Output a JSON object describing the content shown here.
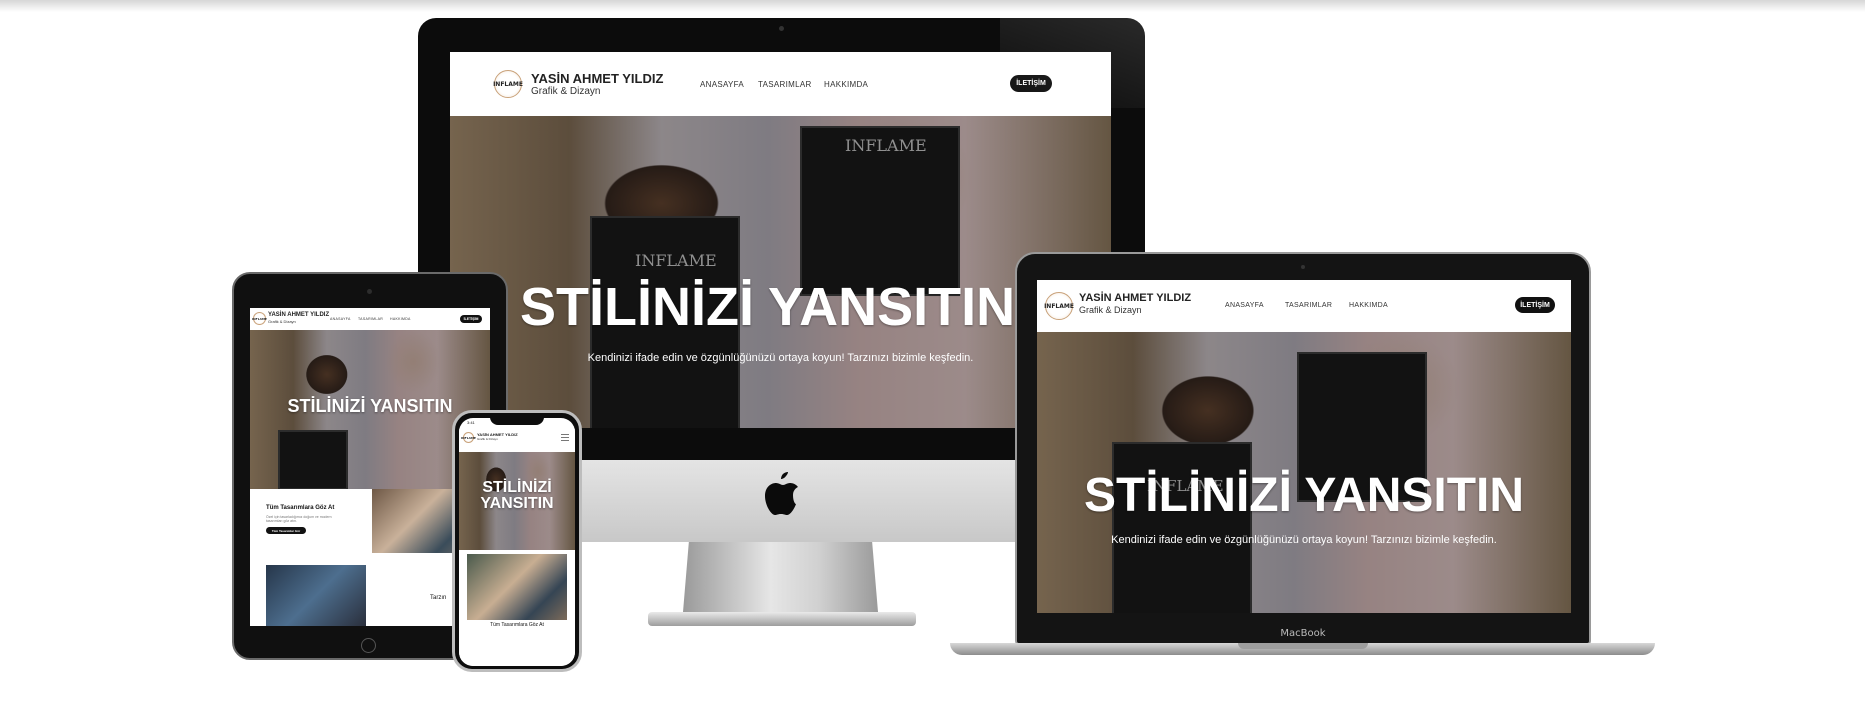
{
  "site": {
    "brand_name": "YASİN AHMET YILDIZ",
    "brand_sub": "Grafik & Dizayn",
    "logo_text": "INFLAME",
    "nav": [
      "ANASAYFA",
      "TASARIMLAR",
      "HAKKIMDA"
    ],
    "cta": "İLETİŞİM",
    "hero_title": "STİLİNİZİ YANSITIN",
    "hero_title_line1": "STİLİNİZİ",
    "hero_title_line2": "YANSITIN",
    "hero_sub": "Kendinizi ifade edin ve özgünlüğünüzü ortaya koyun! Tarzınızı bizimle keşfedin.",
    "shirt_text": "INFLAME",
    "section_title": "Tüm Tasarımlara Göz At",
    "section_text": "Özel için tasarladığımız doğum ve modern tasarımları göz atın.",
    "section_button": "Tüm Tasarımlar Gör",
    "section2_title": "Tarzın"
  },
  "phone": {
    "status_time": "3:41",
    "section_title": "Tüm Tasarımlara Göz At"
  },
  "macbook": {
    "label": "MacBook"
  },
  "icons": [
    "apple-logo-icon",
    "hamburger-menu-icon",
    "camera-icon",
    "home-button-icon"
  ]
}
